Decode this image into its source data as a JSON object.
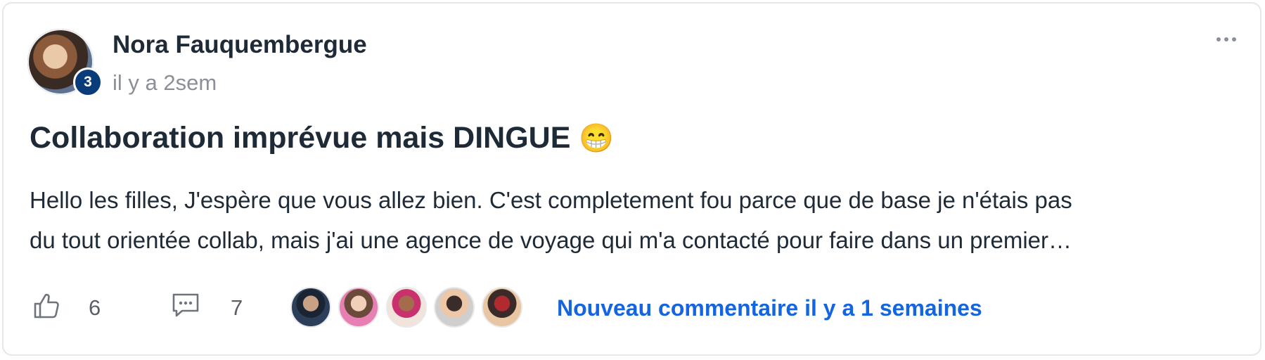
{
  "post": {
    "author": {
      "name": "Nora Fauquembergue",
      "level": "3"
    },
    "time": "il y a 2sem",
    "title": "Collaboration imprévue mais DINGUE",
    "title_emoji": "😁",
    "body_lines": [
      "Hello les filles, J'espère que vous allez bien. C'est completement fou parce que de base je n'étais pas",
      "du tout orientée collab, mais j'ai une agence de voyage qui m'a contacté pour faire dans un premier…"
    ]
  },
  "footer": {
    "likes": "6",
    "comments": "7",
    "participant_avatars": [
      {
        "name": "participant-avatar-1",
        "colors": [
          "#2c3f5a",
          "#c9a184",
          "#1b2433"
        ]
      },
      {
        "name": "participant-avatar-2",
        "colors": [
          "#e77fb3",
          "#f0d0b8",
          "#6a4a3a"
        ]
      },
      {
        "name": "participant-avatar-3",
        "colors": [
          "#f1e4dc",
          "#a46b4c",
          "#c8306e"
        ]
      },
      {
        "name": "participant-avatar-4",
        "colors": [
          "#cfcfcf",
          "#3a2c28",
          "#eec7a8"
        ]
      },
      {
        "name": "participant-avatar-5",
        "colors": [
          "#e8c6a3",
          "#b02a2f",
          "#3b2b28"
        ]
      }
    ],
    "latest_comment": "Nouveau commentaire il y a 1 semaines"
  },
  "icons": {
    "like": "thumbs-up-icon",
    "comment": "comment-bubble-icon",
    "more": "more-horizontal-icon"
  },
  "colors": {
    "accent_link": "#1565e0",
    "badge": "#0b3c7a"
  }
}
